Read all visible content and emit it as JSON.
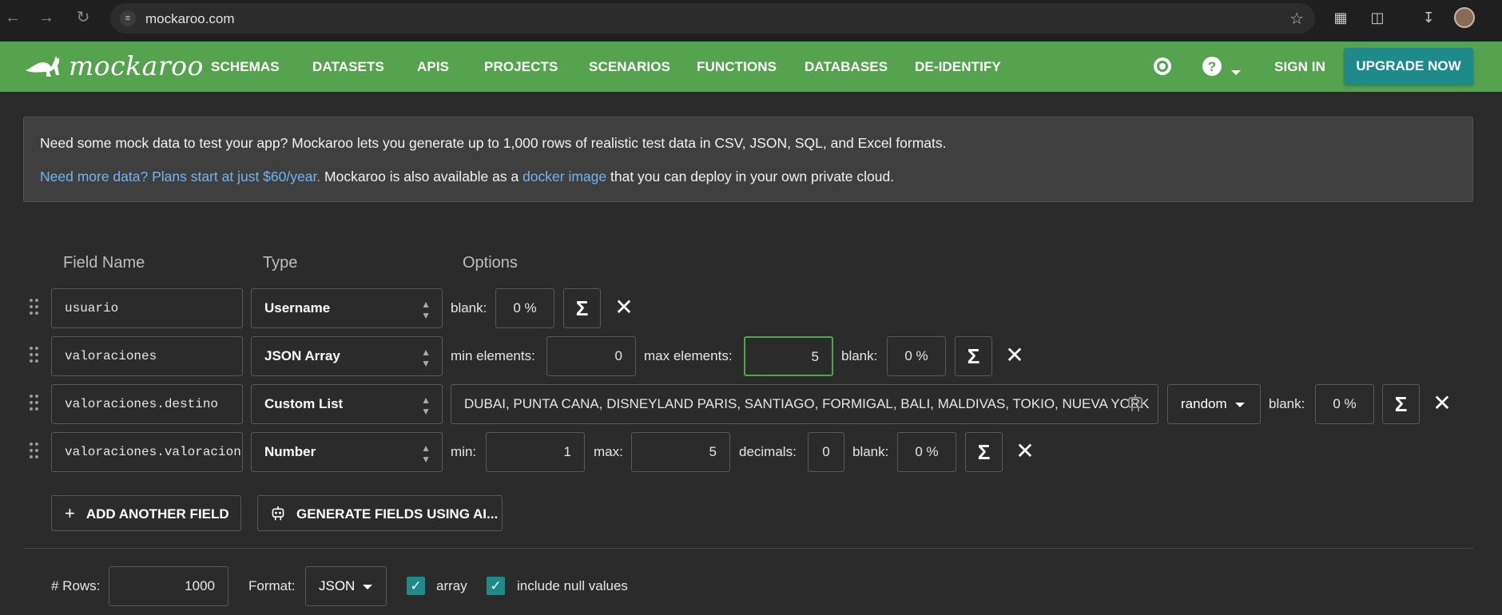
{
  "browser": {
    "url": "mockaroo.com"
  },
  "nav": {
    "brand": "mockaroo",
    "links": [
      "SCHEMAS",
      "DATASETS",
      "APIS",
      "PROJECTS",
      "SCENARIOS",
      "FUNCTIONS",
      "DATABASES",
      "DE-IDENTIFY"
    ],
    "sign_in": "SIGN IN",
    "upgrade": "UPGRADE NOW"
  },
  "info": {
    "line1": "Need some mock data to test your app? Mockaroo lets you generate up to 1,000 rows of realistic test data in CSV, JSON, SQL, and Excel formats.",
    "line2_link": "Need more data? Plans start at just $60/year.",
    "line2_mid": " Mockaroo is also available as a ",
    "line2_link2": "docker image",
    "line2_end": " that you can deploy in your own private cloud."
  },
  "columns": {
    "field_name": "Field Name",
    "type": "Type",
    "options": "Options"
  },
  "rows": [
    {
      "field_name": "usuario",
      "type": "Username",
      "blank_label": "blank:",
      "blank": "0 %"
    },
    {
      "field_name": "valoraciones",
      "type": "JSON Array",
      "min_label": "min elements:",
      "min": "0",
      "max_label": "max elements:",
      "max": "5",
      "blank_label": "blank:",
      "blank": "0 %"
    },
    {
      "field_name": "valoraciones.destino",
      "type": "Custom List",
      "values": "DUBAI, PUNTA CANA, DISNEYLAND PARIS, SANTIAGO, FORMIGAL, BALI, MALDIVAS, TOKIO, NUEVA YORK",
      "order": "random",
      "blank_label": "blank:",
      "blank": "0 %"
    },
    {
      "field_name": "valoraciones.valoracion",
      "type": "Number",
      "min_label": "min:",
      "min": "1",
      "max_label": "max:",
      "max": "5",
      "decimals_label": "decimals:",
      "decimals": "0",
      "blank_label": "blank:",
      "blank": "0 %"
    }
  ],
  "actions": {
    "add_field": "ADD ANOTHER FIELD",
    "generate_ai": "GENERATE FIELDS USING AI..."
  },
  "footer": {
    "rows_label": "# Rows:",
    "rows": "1000",
    "format_label": "Format:",
    "format": "JSON",
    "array_label": "array",
    "array_checked": true,
    "null_label": "include null values",
    "null_checked": true
  },
  "colors": {
    "nav_green": "#55a34f",
    "upgrade_teal": "#1e8a8a",
    "link_blue": "#6fb5f2",
    "focus_green": "#4fa64a"
  }
}
